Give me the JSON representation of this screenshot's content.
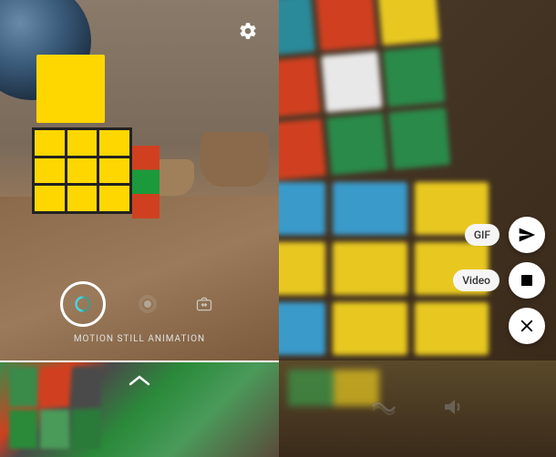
{
  "camera": {
    "mode_label": "MOTION STILL ANIMATION",
    "settings_icon": "gear",
    "shutter_icon": "motion-swirl",
    "switch_mode_icon": "fast-forward-swirl",
    "flip_camera_icon": "camera-flip"
  },
  "thumbnail": {
    "expand_icon": "chevron-up"
  },
  "preview": {
    "actions": {
      "gif_label": "GIF",
      "video_label": "Video",
      "send_icon": "send",
      "film_icon": "film",
      "close_icon": "close"
    },
    "bottom": {
      "stabilize_icon": "wave",
      "audio_icon": "speaker"
    }
  }
}
